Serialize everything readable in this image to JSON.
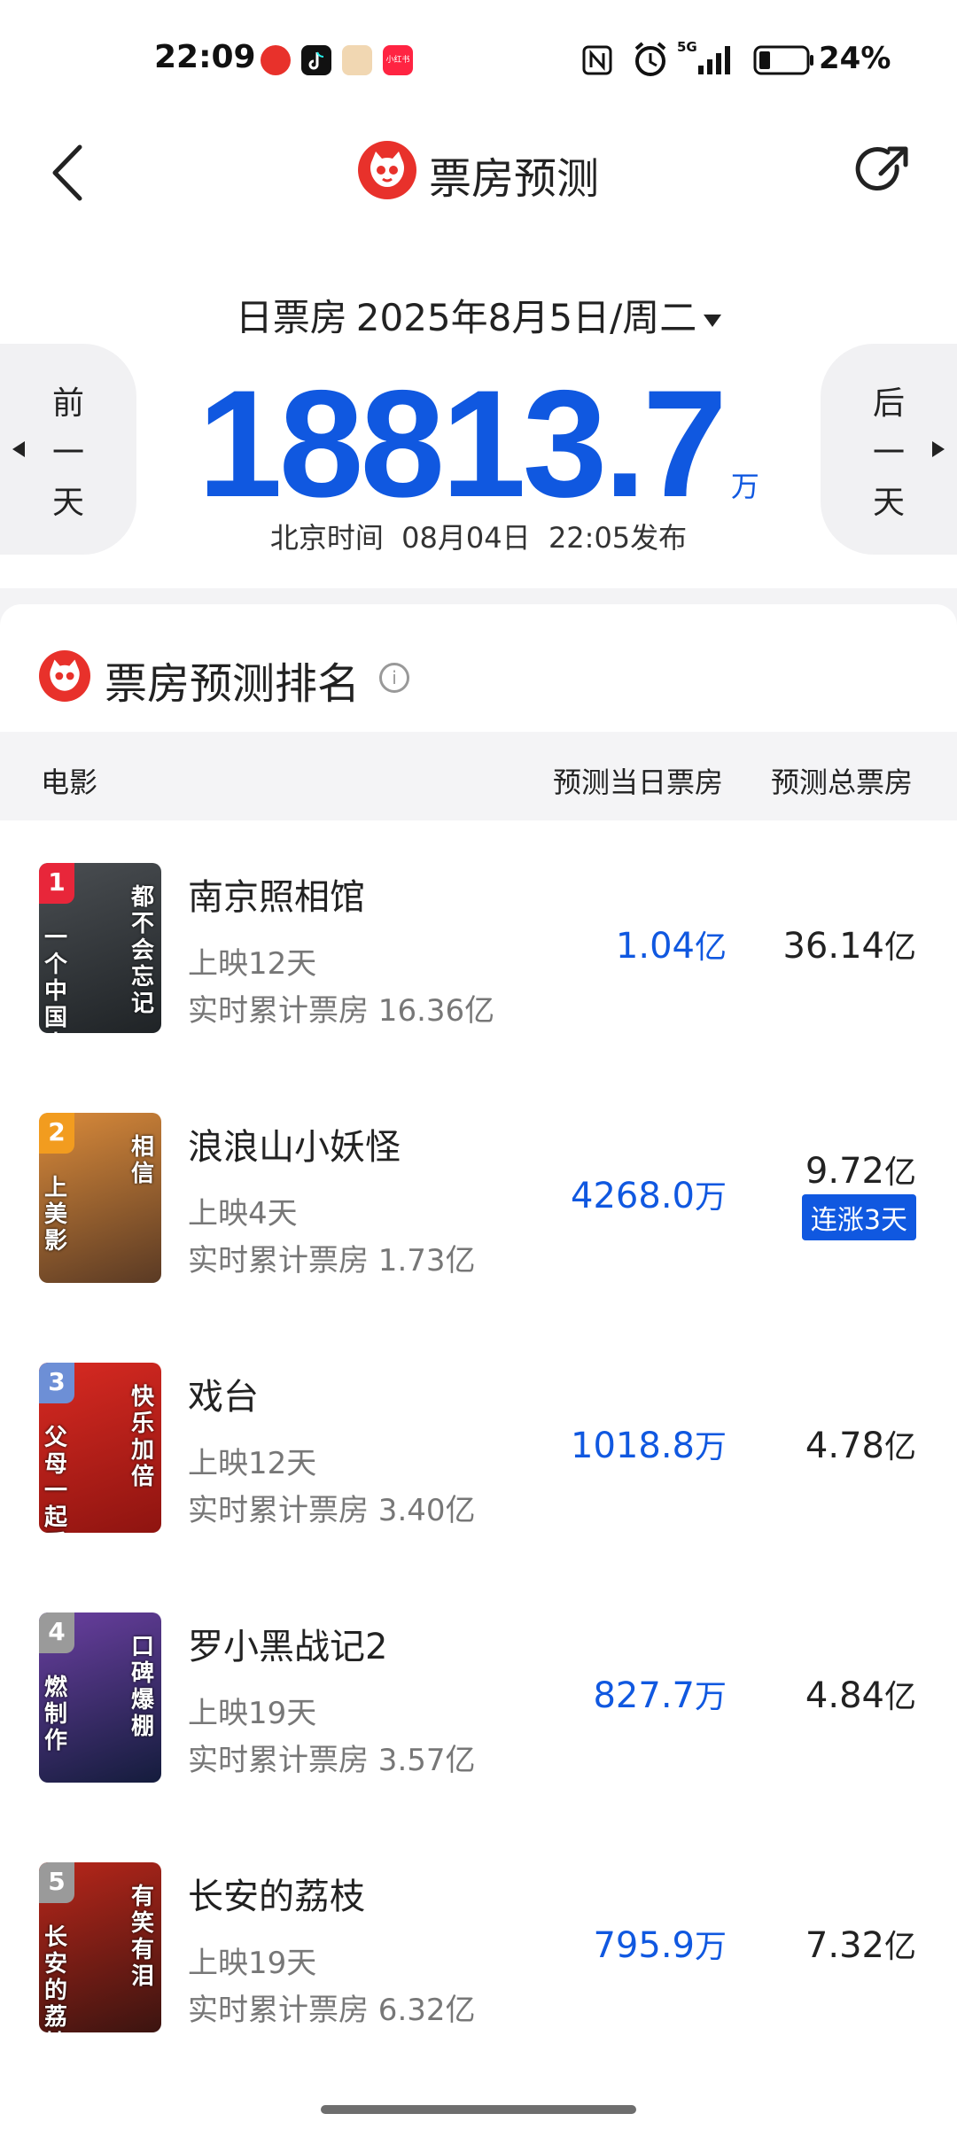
{
  "status_bar": {
    "time": "22:09",
    "app_icons": [
      "maoyan-icon",
      "tiktok-icon",
      "pet-app-icon",
      "xiaohongshu-icon"
    ],
    "xiaohongshu_text": "小红书",
    "network": "5G",
    "battery": "24%"
  },
  "header": {
    "title": "票房预测"
  },
  "date_selector": {
    "label": "日票房",
    "date": "2025年8月5日/周二"
  },
  "summary": {
    "value": "18813.7",
    "unit": "万",
    "published": "北京时间  08月04日  22:05发布"
  },
  "nav": {
    "prev_label": "前一天",
    "next_label": "后一天"
  },
  "ranking": {
    "title": "票房预测排名",
    "columns": {
      "movie": "电影",
      "today": "预测当日票房",
      "total": "预测总票房"
    },
    "movies": [
      {
        "rank": "1",
        "title": "南京照相馆",
        "days": "上映12天",
        "cumulative": "实时累计票房 16.36亿",
        "today_value": "1.04",
        "today_unit": "亿",
        "total_value": "36.14",
        "total_unit": "亿",
        "badge": "",
        "poster_text_a": "都不会忘记",
        "poster_text_b": "一个中国人",
        "poster_colors": [
          "#4a4e52",
          "#1f2326"
        ],
        "badge_color": "#e8263a"
      },
      {
        "rank": "2",
        "title": "浪浪山小妖怪",
        "days": "上映4天",
        "cumulative": "实时累计票房 1.73亿",
        "today_value": "4268.0",
        "today_unit": "万",
        "total_value": "9.72",
        "total_unit": "亿",
        "badge": "连涨3天",
        "poster_text_a": "相信",
        "poster_text_b": "上美影",
        "poster_colors": [
          "#d98a3a",
          "#5a3a24"
        ],
        "badge_color": "#f29c1f"
      },
      {
        "rank": "3",
        "title": "戏台",
        "days": "上映12天",
        "cumulative": "实时累计票房 3.40亿",
        "today_value": "1018.8",
        "today_unit": "万",
        "total_value": "4.78",
        "total_unit": "亿",
        "badge": "",
        "poster_text_a": "快乐加倍",
        "poster_text_b": "父母一起看",
        "poster_colors": [
          "#d82a22",
          "#8e1410"
        ],
        "badge_color": "#6d8fd6"
      },
      {
        "rank": "4",
        "title": "罗小黑战记2",
        "days": "上映19天",
        "cumulative": "实时累计票房 3.57亿",
        "today_value": "827.7",
        "today_unit": "万",
        "total_value": "4.84",
        "total_unit": "亿",
        "badge": "",
        "poster_text_a": "口碑爆棚",
        "poster_text_b": "燃制作",
        "poster_colors": [
          "#6a3fa0",
          "#141c3c"
        ],
        "badge_color": "#9a9a9a"
      },
      {
        "rank": "5",
        "title": "长安的荔枝",
        "days": "上映19天",
        "cumulative": "实时累计票房 6.32亿",
        "today_value": "795.9",
        "today_unit": "万",
        "total_value": "7.32",
        "total_unit": "亿",
        "badge": "",
        "poster_text_a": "有笑有泪",
        "poster_text_b": "长安的荔枝",
        "poster_colors": [
          "#b8261a",
          "#3b1410"
        ],
        "badge_color": "#9a9a9a"
      }
    ]
  }
}
